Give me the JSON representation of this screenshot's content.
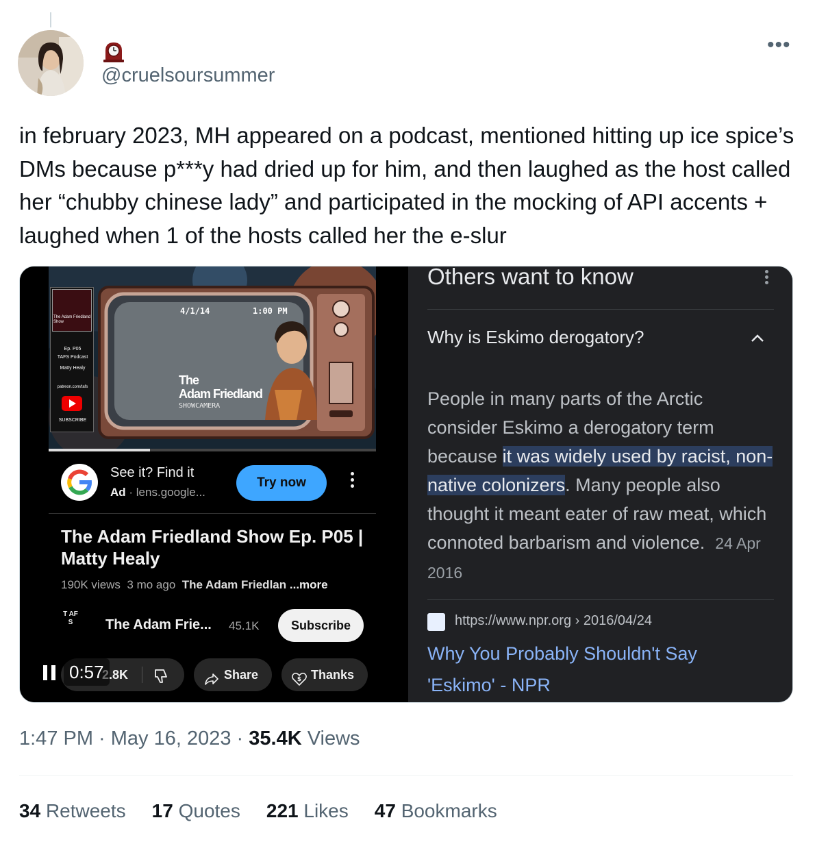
{
  "author": {
    "handle": "@cruelsoursummer",
    "name_emoji": "mantelpiece-clock-emoji"
  },
  "tweet": {
    "text": "in february 2023, MH appeared on a podcast, mentioned hitting up ice spice’s DMs because p***y had dried up for him, and then laughed as the host called her “chubby chinese lady” and participated in the mocking of API accents + laughed when 1 of the hosts called her the e-slur",
    "timestamp": "1:47 PM · May 16, 2023 · ",
    "views_count": "35.4K",
    "views_label": " Views"
  },
  "video": {
    "thumbnail": {
      "date": "4/1/14",
      "time": "1:00 PM",
      "show_name_line1": "The",
      "show_name_line2": "Adam Friedland",
      "show_sub": "SHOWCAMERA",
      "side_title": "The Adam Friedland Show",
      "side_ep": "Ep. P05",
      "side_podcast": "TAFS Podcast",
      "side_guest": "Matty Healy",
      "side_patreon": "patreon.com/tafs",
      "side_subscribe": "SUBSCRIBE"
    },
    "progress": 0.31,
    "ad": {
      "title": "See it? Find it",
      "label": "Ad",
      "url": "lens.google...",
      "cta": "Try now"
    },
    "title": "The Adam Friedland Show Ep. P05 | Matty Healy",
    "views": "190K views",
    "age": "3 mo ago",
    "channel_short": "The Adam Friedlan",
    "more": "...more",
    "channel_logo": "T AF S",
    "channel_name": "The Adam Frie...",
    "subscribers": "45.1K",
    "subscribe_label": "Subscribe",
    "likes": "2.8K",
    "share_label": "Share",
    "thanks_label": "Thanks",
    "playback_time": "0:57"
  },
  "google": {
    "section_title": "Others want to know",
    "question": "Why is Eskimo derogatory?",
    "answer_before": "People in many parts of the Arctic consider Eskimo a derogatory term because ",
    "answer_highlight": "it was widely used by racist, non-native colonizers",
    "answer_after": ". Many people also thought it meant eater of raw meat, which connoted barbarism and violence.",
    "answer_date": "24 Apr 2016",
    "source_url": "https://www.npr.org › 2016/04/24",
    "source_title": "Why You Probably Shouldn't Say 'Eskimo' - NPR"
  },
  "stats": [
    {
      "count": "34",
      "label": "Retweets"
    },
    {
      "count": "17",
      "label": "Quotes"
    },
    {
      "count": "221",
      "label": "Likes"
    },
    {
      "count": "47",
      "label": "Bookmarks"
    }
  ],
  "colors": {
    "youtube_blue": "#3ea6ff",
    "google_link": "#8ab4f8",
    "highlight": "#2c3e5e"
  }
}
